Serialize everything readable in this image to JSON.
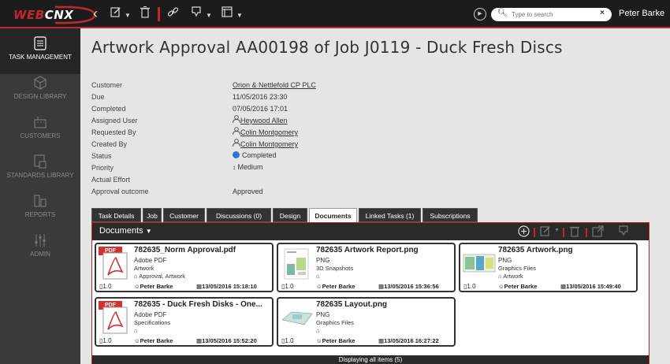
{
  "app": {
    "logo_part1": "WEB",
    "logo_part2": "CNX",
    "user_name": "Peter Barke",
    "search_placeholder": "Type to search",
    "accent_color": "#c0282d"
  },
  "sidebar": {
    "items": [
      {
        "label": "TASK MANAGEMENT",
        "icon": "task-list-icon",
        "active": true
      },
      {
        "label": "DESIGN LIBRARY",
        "icon": "cube-icon",
        "active": false
      },
      {
        "label": "CUSTOMERS",
        "icon": "building-icon",
        "active": false
      },
      {
        "label": "STANDARDS LIBRARY",
        "icon": "standards-icon",
        "active": false
      },
      {
        "label": "REPORTS",
        "icon": "bar-chart-icon",
        "active": false
      },
      {
        "label": "ADMIN",
        "icon": "sliders-icon",
        "active": false
      }
    ]
  },
  "page": {
    "title": "Artwork Approval AA00198 of Job J0119 - Duck Fresh Discs"
  },
  "fields": [
    {
      "label": "Customer",
      "value": "Orion & Nettlefold CP PLC",
      "link": true,
      "icon": ""
    },
    {
      "label": "Due",
      "value": "11/05/2016 23:30",
      "link": false,
      "icon": ""
    },
    {
      "label": "Completed",
      "value": "07/05/2016 17:01",
      "link": false,
      "icon": ""
    },
    {
      "label": "Assigned User",
      "value": "Heywood Allen",
      "link": true,
      "icon": "user-icon"
    },
    {
      "label": "Requested By",
      "value": "Colin Montgomery",
      "link": true,
      "icon": "user-icon"
    },
    {
      "label": "Created By",
      "value": "Colin Montgomery",
      "link": true,
      "icon": "user-icon"
    },
    {
      "label": "Status",
      "value": "Completed",
      "link": false,
      "icon": "status-dot-icon"
    },
    {
      "label": "Priority",
      "value": "Medium",
      "link": false,
      "icon": "priority-icon"
    },
    {
      "label": "Actual Effort",
      "value": "",
      "link": false,
      "icon": ""
    },
    {
      "label": "Approval outcome",
      "value": "Approved",
      "link": false,
      "icon": ""
    }
  ],
  "tabs": [
    {
      "label": "Task Details",
      "active": false
    },
    {
      "label": "Job",
      "active": false
    },
    {
      "label": "Customer",
      "active": false
    },
    {
      "label": "Discussions (0)",
      "active": false
    },
    {
      "label": "Design",
      "active": false
    },
    {
      "label": "Documents",
      "active": true
    },
    {
      "label": "Linked Tasks (1)",
      "active": false
    },
    {
      "label": "Subscriptions",
      "active": false
    }
  ],
  "documents": {
    "title": "Documents",
    "footer": "Displaying all items (5)",
    "cards": [
      {
        "name": "782635_Norm Approval.pdf",
        "type": "Adobe PDF",
        "category": "Artwork",
        "tags": "Approval, Artwork",
        "version": "1.0",
        "owner": "Peter Barke",
        "date": "13/05/2016 15:18:10",
        "thumb": "pdf"
      },
      {
        "name": "782635 Artwork Report.png",
        "type": "PNG",
        "category": "3D Snapshots",
        "tags": "",
        "version": "1.0",
        "owner": "Peter Barke",
        "date": "13/05/2016 15:36:56",
        "thumb": "report"
      },
      {
        "name": "782635 Artwork.png",
        "type": "PNG",
        "category": "Graphics Files",
        "tags": "Artwork",
        "version": "1.0",
        "owner": "Peter Barke",
        "date": "13/05/2016 15:49:40",
        "thumb": "artwork"
      },
      {
        "name": "782635 - Duck Fresh Disks - One...",
        "type": "Adobe PDF",
        "category": "Specifications",
        "tags": "",
        "version": "1.0",
        "owner": "Peter Barke",
        "date": "13/05/2016 15:52:20",
        "thumb": "pdf"
      },
      {
        "name": "782635 Layout.png",
        "type": "PNG",
        "category": "Graphics Files",
        "tags": "",
        "version": "1.0",
        "owner": "Peter Barke",
        "date": "13/05/2016 16:27:22",
        "thumb": "layout"
      }
    ]
  }
}
